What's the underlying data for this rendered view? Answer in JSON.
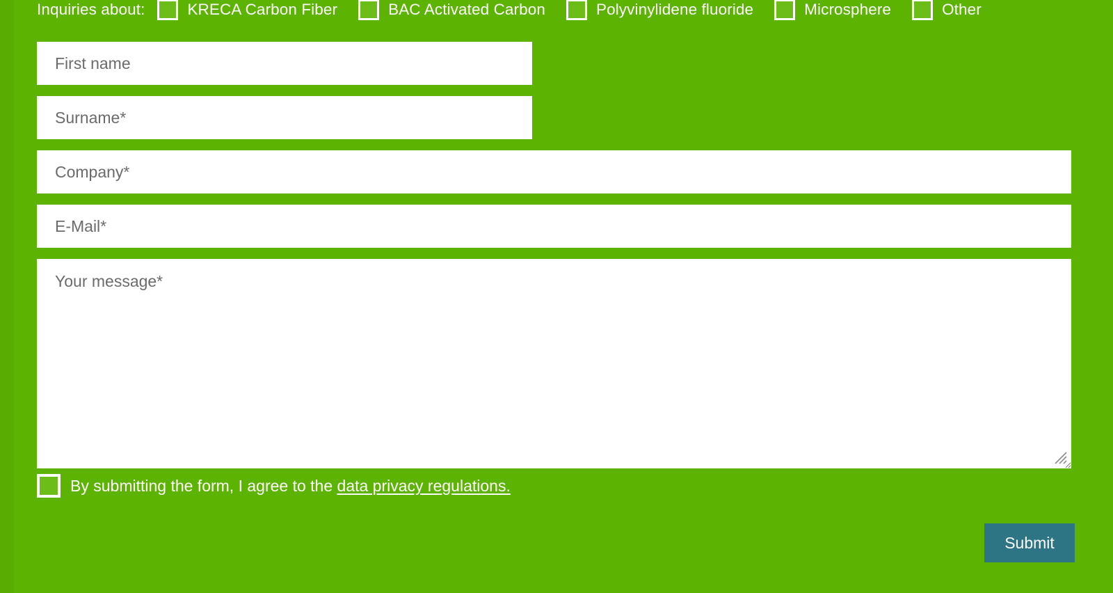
{
  "theme": {
    "background_green": "#5cb302",
    "checkbox_fill_green": "#6cbd17",
    "submit_teal": "#2d7484",
    "field_white": "#ffffff",
    "placeholder_gray": "#6b6b6b",
    "text_white": "#ffffff"
  },
  "inquiry": {
    "label": "Inquiries about:",
    "options": [
      {
        "label": "KRECA Carbon Fiber",
        "checked": false
      },
      {
        "label": "BAC Activated Carbon",
        "checked": false
      },
      {
        "label": "Polyvinylidene fluoride",
        "checked": false
      },
      {
        "label": "Microsphere",
        "checked": false
      },
      {
        "label": "Other",
        "checked": false
      }
    ]
  },
  "fields": {
    "first_name": {
      "placeholder": "First name",
      "value": ""
    },
    "surname": {
      "placeholder": "Surname*",
      "value": ""
    },
    "company": {
      "placeholder": "Company*",
      "value": ""
    },
    "email": {
      "placeholder": "E-Mail*",
      "value": ""
    },
    "message": {
      "placeholder": "Your message*",
      "value": ""
    }
  },
  "consent": {
    "checked": false,
    "text_before_link": "By submitting the form, I agree to the ",
    "link_text": "data privacy regulations."
  },
  "submit": {
    "label": "Submit"
  },
  "icons": {
    "resize_grip": "resize-grip-icon",
    "checkbox": "checkbox-icon"
  }
}
